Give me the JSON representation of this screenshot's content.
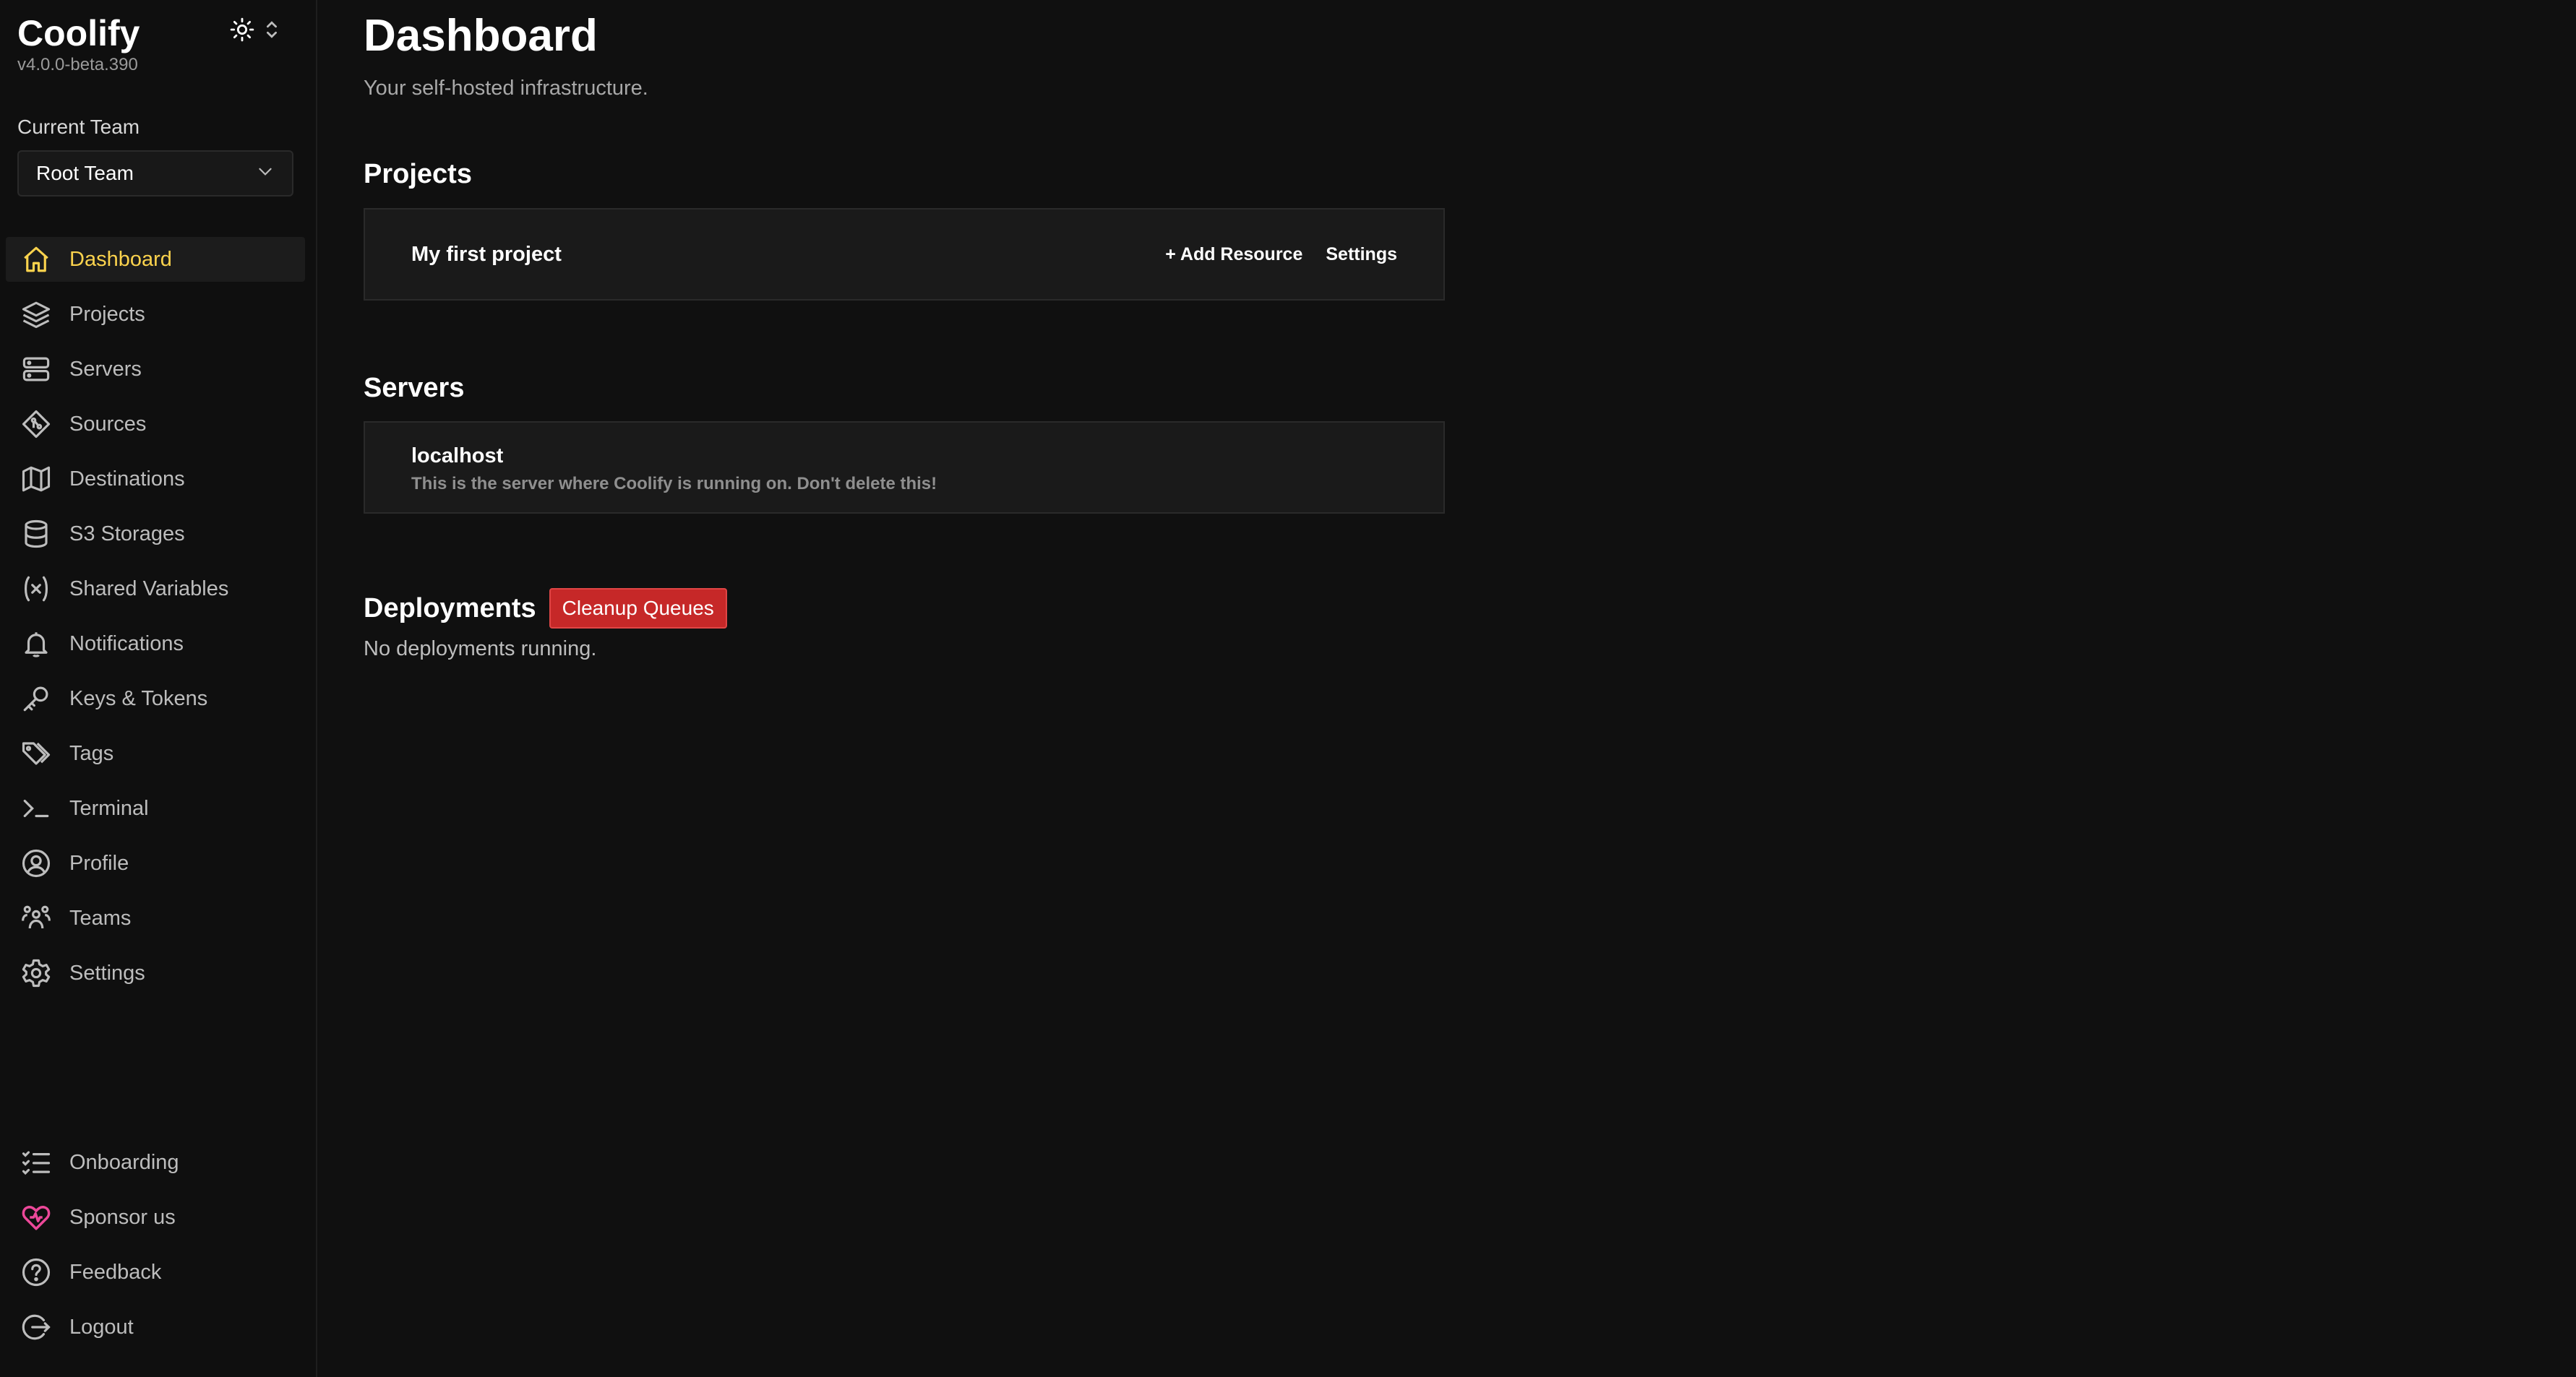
{
  "brand": {
    "title": "Coolify",
    "version": "v4.0.0-beta.390"
  },
  "team": {
    "label": "Current Team",
    "selected": "Root Team"
  },
  "nav": {
    "items": [
      {
        "label": "Dashboard",
        "icon": "home-icon",
        "active": true
      },
      {
        "label": "Projects",
        "icon": "layers-icon"
      },
      {
        "label": "Servers",
        "icon": "server-icon"
      },
      {
        "label": "Sources",
        "icon": "git-icon"
      },
      {
        "label": "Destinations",
        "icon": "map-icon"
      },
      {
        "label": "S3 Storages",
        "icon": "database-icon"
      },
      {
        "label": "Shared Variables",
        "icon": "variable-icon"
      },
      {
        "label": "Notifications",
        "icon": "bell-icon"
      },
      {
        "label": "Keys & Tokens",
        "icon": "key-icon"
      },
      {
        "label": "Tags",
        "icon": "tags-icon"
      },
      {
        "label": "Terminal",
        "icon": "terminal-icon"
      },
      {
        "label": "Profile",
        "icon": "user-circle-icon"
      },
      {
        "label": "Teams",
        "icon": "users-icon"
      },
      {
        "label": "Settings",
        "icon": "gear-icon"
      }
    ],
    "bottom": [
      {
        "label": "Onboarding",
        "icon": "checklist-icon"
      },
      {
        "label": "Sponsor us",
        "icon": "heart-icon"
      },
      {
        "label": "Feedback",
        "icon": "help-circle-icon"
      },
      {
        "label": "Logout",
        "icon": "logout-icon"
      }
    ]
  },
  "colors": {
    "accent": "#fcd34d",
    "danger": "#c62828",
    "sponsor": "#ec4899"
  },
  "page": {
    "title": "Dashboard",
    "subtitle": "Your self-hosted infrastructure."
  },
  "projects": {
    "title": "Projects",
    "items": [
      {
        "name": "My first project",
        "add_label": "+ Add Resource",
        "settings_label": "Settings"
      }
    ]
  },
  "servers": {
    "title": "Servers",
    "items": [
      {
        "name": "localhost",
        "description": "This is the server where Coolify is running on. Don't delete this!"
      }
    ]
  },
  "deployments": {
    "title": "Deployments",
    "cleanup_label": "Cleanup Queues",
    "empty_text": "No deployments running."
  }
}
